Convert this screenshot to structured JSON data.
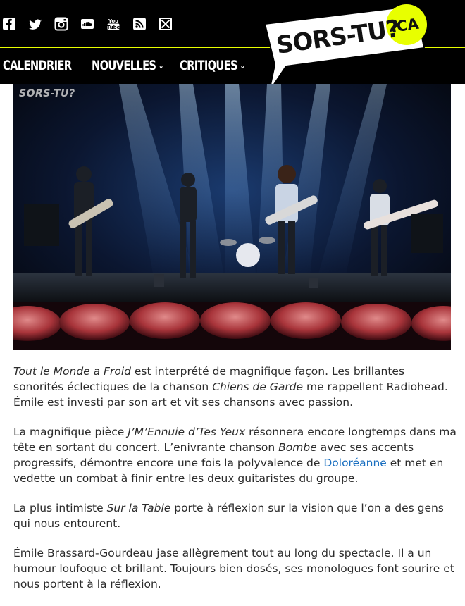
{
  "header": {
    "social_icons": [
      "facebook-icon",
      "twitter-icon",
      "instagram-icon",
      "soundcloud-icon",
      "youtube-icon",
      "rss-icon",
      "newsletter-icon"
    ],
    "logo_text": "SORS-TU?",
    "logo_domain": ".CA",
    "accent_color": "#e8ff00"
  },
  "nav": {
    "items": [
      {
        "label": "CALENDRIER",
        "has_dropdown": false
      },
      {
        "label": "NOUVELLES",
        "has_dropdown": true
      },
      {
        "label": "CRITIQUES",
        "has_dropdown": true
      }
    ]
  },
  "photo": {
    "watermark": "SORS-TU?"
  },
  "article": {
    "p1": {
      "t1": "Tout le Monde a Froid",
      "t2": " est interprété de magnifique façon. Les brillantes sonorités éclectiques de la chanson ",
      "t3": "Chiens de Garde",
      "t4": " me rappellent Radiohead. Émile est investi par son art et vit ses chansons avec passion."
    },
    "p2": {
      "t1": "La magnifique pièce ",
      "t2": "J’M’Ennuie d’Tes Yeux",
      "t3": " résonnera encore longtemps dans ma tête en sortant du concert. L’enivrante chanson ",
      "t4": "Bombe",
      "t5": " avec ses accents progressifs, démontre encore une fois la polyvalence de ",
      "link": "Doloréanne",
      "t6": " et met en vedette un combat à finir entre les deux guitaristes du groupe."
    },
    "p3": {
      "t1": "La plus intimiste ",
      "t2": "Sur la Table",
      "t3": " porte à réflexion sur la vision que l’on a des gens qui nous entourent."
    },
    "p4": {
      "t1": "Émile Brassard-Gourdeau jase allègrement tout au long du spectacle. Il a un humour loufoque et brillant. Toujours bien dosés, ses monologues font sourire et nous portent à la réflexion."
    },
    "link_color": "#1a6fc0"
  }
}
